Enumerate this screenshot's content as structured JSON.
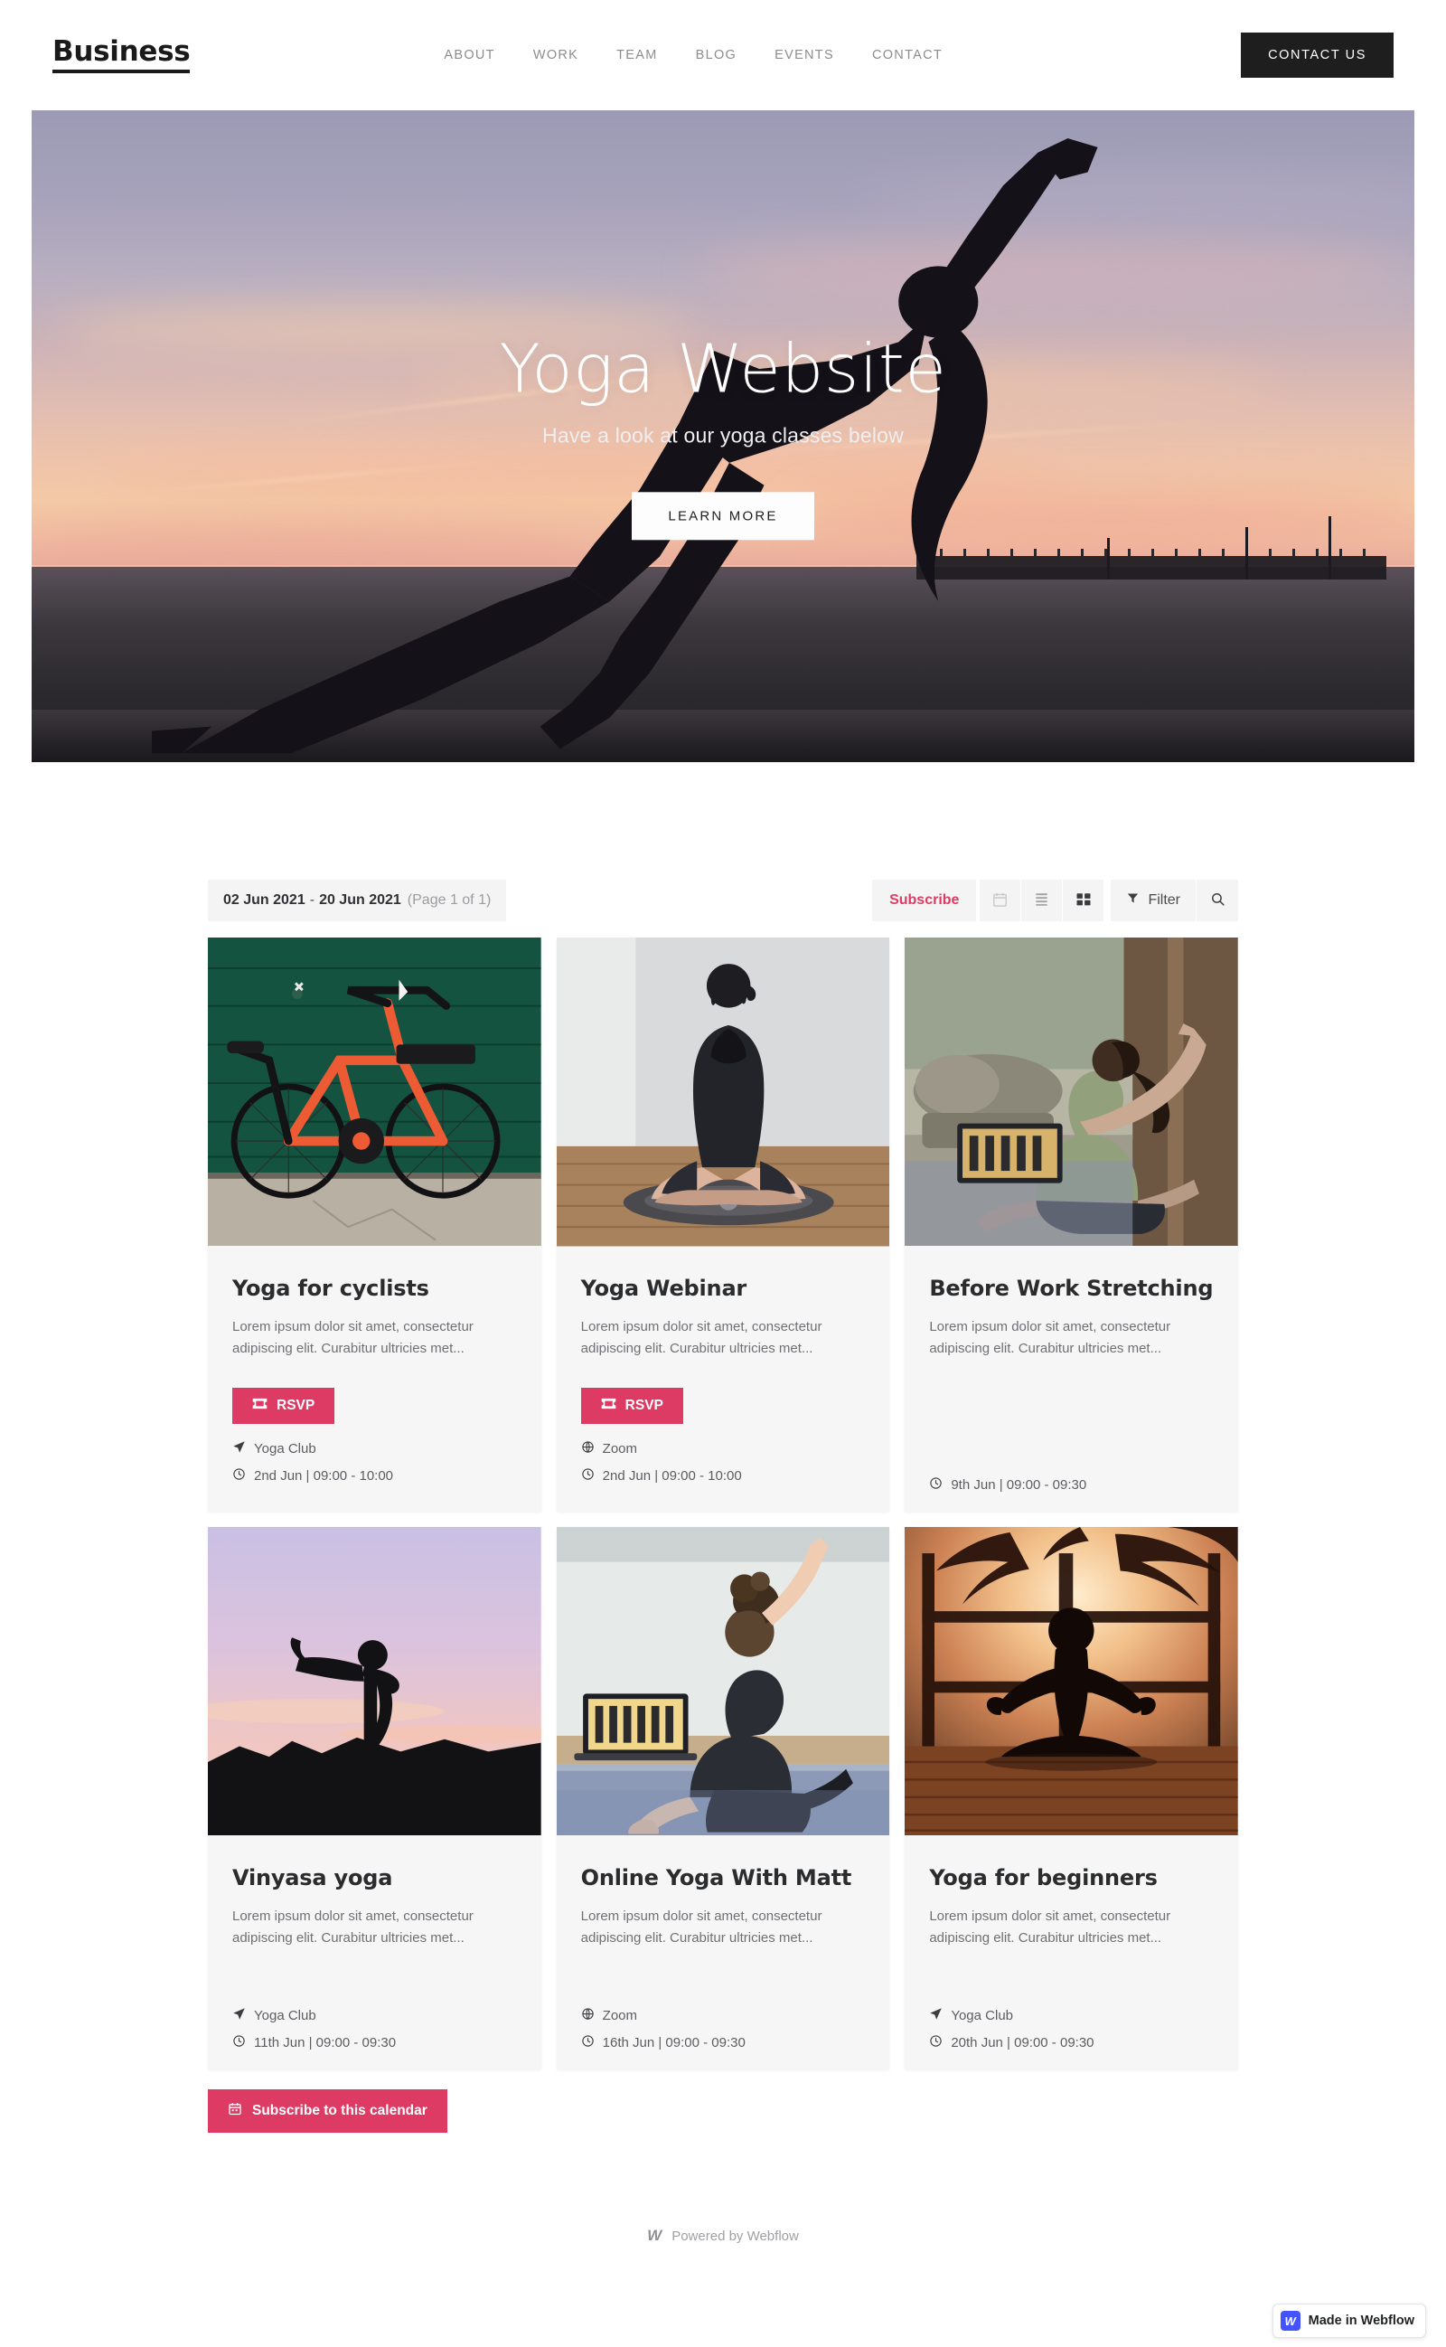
{
  "nav": {
    "brand": "Business",
    "links": [
      "ABOUT",
      "WORK",
      "TEAM",
      "BLOG",
      "EVENTS",
      "CONTACT"
    ],
    "cta": "CONTACT US"
  },
  "hero": {
    "title": "Yoga Website",
    "subtitle": "Have a look at our yoga classes below",
    "button": "LEARN MORE"
  },
  "calendar": {
    "range_start": "02 Jun 2021",
    "range_separator": "-",
    "range_end": "20 Jun 2021",
    "page_info": "(Page 1 of 1)",
    "subscribe_label": "Subscribe",
    "filter_label": "Filter",
    "views": [
      {
        "name": "calendar-view",
        "icon": "calendar-icon",
        "active": false
      },
      {
        "name": "list-view",
        "icon": "list-icon",
        "active": false
      },
      {
        "name": "grid-view",
        "icon": "grid-icon",
        "active": true
      }
    ],
    "search_icon": "search-icon",
    "subscribe_calendar_label": "Subscribe to this calendar"
  },
  "events": [
    {
      "title": "Yoga for cyclists",
      "description": "Lorem ipsum dolor sit amet, consectetur adipiscing elit. Curabitur ultricies met...",
      "rsvp": "RSVP",
      "has_rsvp": true,
      "location": "Yoga Club",
      "location_icon": "location-arrow-icon",
      "datetime": "2nd Jun | 09:00 - 10:00",
      "image": "bicycle-green-wall"
    },
    {
      "title": "Yoga Webinar",
      "description": "Lorem ipsum dolor sit amet, consectetur adipiscing elit. Curabitur ultricies met...",
      "rsvp": "RSVP",
      "has_rsvp": true,
      "location": "Zoom",
      "location_icon": "globe-icon",
      "datetime": "2nd Jun | 09:00 - 10:00",
      "image": "woman-seated-meditation"
    },
    {
      "title": "Before Work Stretching",
      "description": "Lorem ipsum dolor sit amet, consectetur adipiscing elit. Curabitur ultricies met...",
      "rsvp": "",
      "has_rsvp": false,
      "location": "",
      "location_icon": "",
      "datetime": "9th Jun | 09:00 - 09:30",
      "image": "woman-side-bend-indoors"
    },
    {
      "title": "Vinyasa yoga",
      "description": "Lorem ipsum dolor sit amet, consectetur adipiscing elit. Curabitur ultricies met...",
      "rsvp": "",
      "has_rsvp": false,
      "location": "Yoga Club",
      "location_icon": "location-arrow-icon",
      "datetime": "11th Jun | 09:00 - 09:30",
      "image": "silhouette-warrior-sunset"
    },
    {
      "title": "Online Yoga With Matt",
      "description": "Lorem ipsum dolor sit amet, consectetur adipiscing elit. Curabitur ultricies met...",
      "rsvp": "",
      "has_rsvp": false,
      "location": "Zoom",
      "location_icon": "globe-icon",
      "datetime": "16th Jun | 09:00 - 09:30",
      "image": "woman-laptop-stretch"
    },
    {
      "title": "Yoga for beginners",
      "description": "Lorem ipsum dolor sit amet, consectetur adipiscing elit. Curabitur ultricies met...",
      "rsvp": "",
      "has_rsvp": false,
      "location": "Yoga Club",
      "location_icon": "location-arrow-icon",
      "datetime": "20th Jun | 09:00 - 09:30",
      "image": "lotus-silhouette-palms"
    }
  ],
  "footer": {
    "powered_by": "Powered by Webflow",
    "badge": "Made in Webflow",
    "badge_mark": "W",
    "webflow_mark": "W"
  },
  "colors": {
    "accent": "#dd3b63",
    "dark": "#1e1e1e",
    "card_bg": "#f6f6f7",
    "toolbar_bg": "#f4f4f5",
    "muted_text": "#6e7073",
    "badge_blue": "#4353ff"
  }
}
